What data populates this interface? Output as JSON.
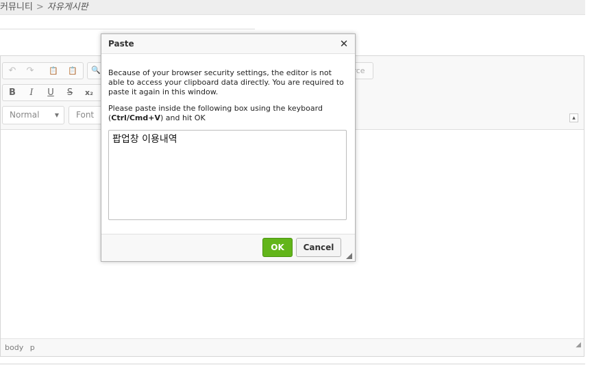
{
  "breadcrumb": {
    "parent": "커뮤니티",
    "separator": ">",
    "current": "자유게시판"
  },
  "editor": {
    "toolbar": {
      "undo_icon": "↶",
      "redo_icon": "↷",
      "paste_text_icon": "📋",
      "paste_word_icon": "📋",
      "find_icon": "🔍",
      "source_label_fragment": "rce",
      "bold_icon": "B",
      "italic_icon": "I",
      "underline_icon": "U",
      "strike_icon": "S",
      "subscript_icon": "x₂",
      "format_value": "Normal",
      "font_value": "Font",
      "collapse_icon": "▲"
    },
    "statusbar": {
      "path": [
        "body",
        "p"
      ],
      "resize_icon": "◢"
    }
  },
  "dialog": {
    "title": "Paste",
    "close_icon": "✕",
    "message": "Because of your browser security settings, the editor is not able to access your clipboard data directly. You are required to paste it again in this window.",
    "instruction_prefix": "Please paste inside the following box using the keyboard (",
    "shortcut": "Ctrl/Cmd+V",
    "instruction_suffix": ") and hit OK",
    "paste_content": "팝업창 이용내역",
    "ok_label": "OK",
    "cancel_label": "Cancel"
  },
  "colors": {
    "ok_button": "#62b51a",
    "breadcrumb_bg": "#eeeeee",
    "toolbar_bg": "#f8f8f8"
  }
}
